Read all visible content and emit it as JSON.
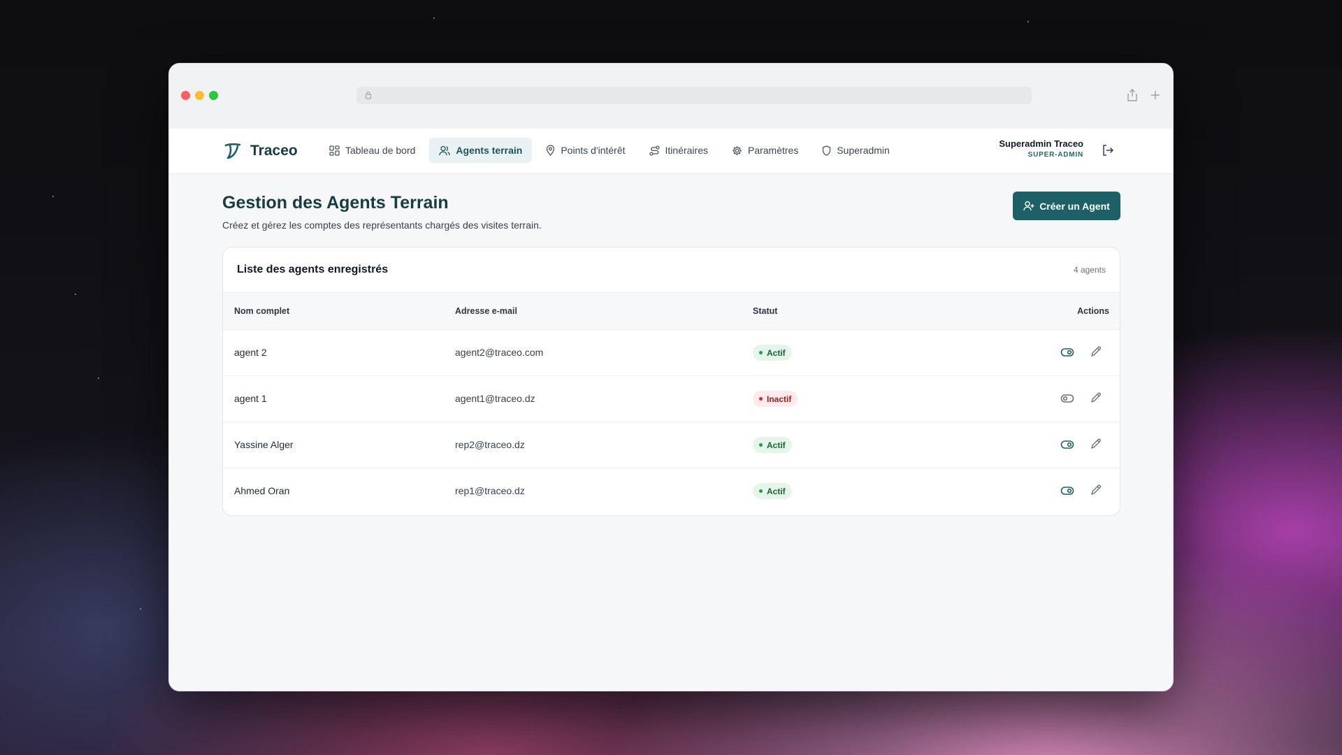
{
  "app": {
    "name": "Traceo"
  },
  "nav": {
    "items": [
      {
        "label": "Tableau de bord",
        "icon": "dashboard-grid-icon",
        "active": false
      },
      {
        "label": "Agents terrain",
        "icon": "users-icon",
        "active": true
      },
      {
        "label": "Points d'intérêt",
        "icon": "map-pin-icon",
        "active": false
      },
      {
        "label": "Itinéraires",
        "icon": "route-icon",
        "active": false
      },
      {
        "label": "Paramètres",
        "icon": "gear-icon",
        "active": false
      },
      {
        "label": "Superadmin",
        "icon": "shield-icon",
        "active": false
      }
    ]
  },
  "user": {
    "name": "Superadmin Traceo",
    "role": "SUPER-ADMIN"
  },
  "page": {
    "title": "Gestion des Agents Terrain",
    "subtitle": "Créez et gérez les comptes des représentants chargés des visites terrain.",
    "create_button": "Créer un Agent"
  },
  "table": {
    "title": "Liste des agents enregistrés",
    "count": "4 agents",
    "columns": {
      "name": "Nom complet",
      "email": "Adresse e-mail",
      "status": "Statut",
      "actions": "Actions"
    },
    "rows": [
      {
        "name": "agent 2",
        "email": "agent2@traceo.com",
        "status": "Actif",
        "active": true
      },
      {
        "name": "agent 1",
        "email": "agent1@traceo.dz",
        "status": "Inactif",
        "active": false
      },
      {
        "name": "Yassine Alger",
        "email": "rep2@traceo.dz",
        "status": "Actif",
        "active": true
      },
      {
        "name": "Ahmed Oran",
        "email": "rep1@traceo.dz",
        "status": "Actif",
        "active": true
      }
    ]
  },
  "colors": {
    "brand": "#173d40",
    "primary": "#1d6066",
    "active_nav_bg": "#e9f1f2",
    "success": "#16a34a",
    "danger": "#dc2626"
  }
}
